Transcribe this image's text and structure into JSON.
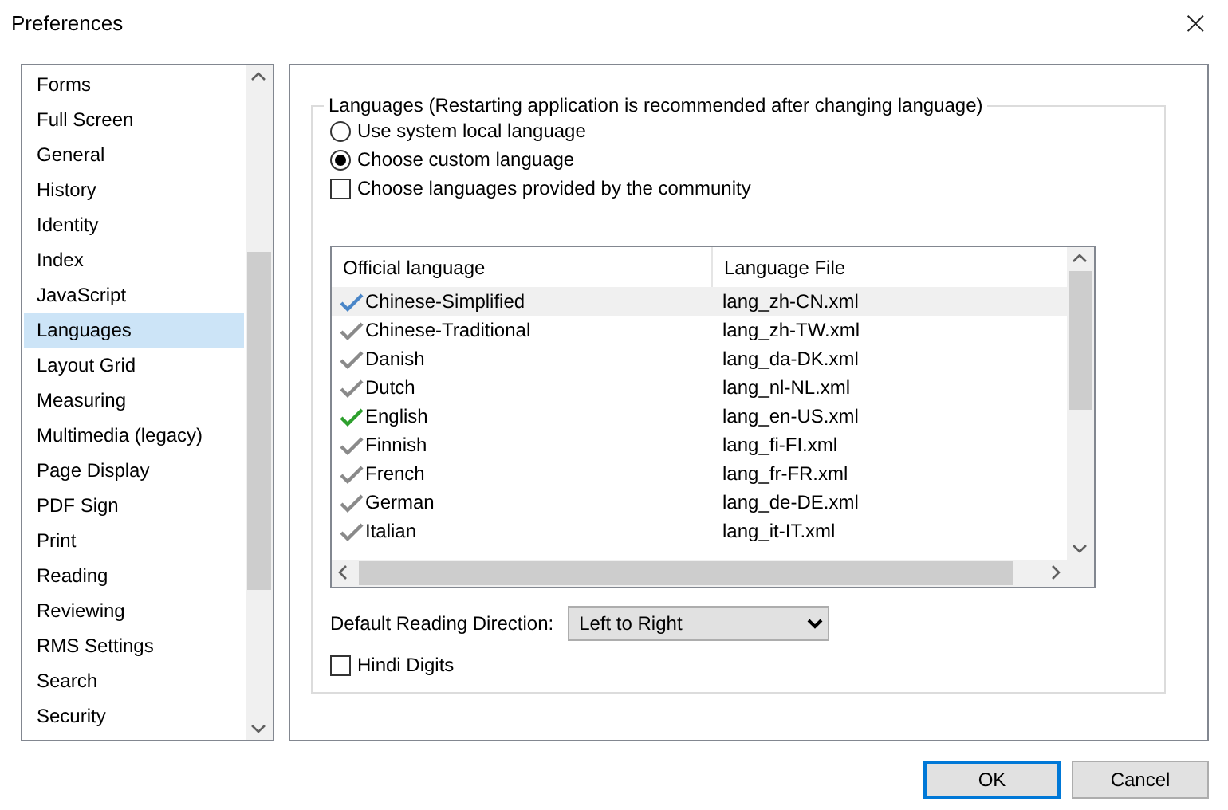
{
  "window": {
    "title": "Preferences",
    "close": "×"
  },
  "sidebar": {
    "items": [
      {
        "label": "Forms",
        "selected": false
      },
      {
        "label": "Full Screen",
        "selected": false
      },
      {
        "label": "General",
        "selected": false
      },
      {
        "label": "History",
        "selected": false
      },
      {
        "label": "Identity",
        "selected": false
      },
      {
        "label": "Index",
        "selected": false
      },
      {
        "label": "JavaScript",
        "selected": false
      },
      {
        "label": "Languages",
        "selected": true
      },
      {
        "label": "Layout Grid",
        "selected": false
      },
      {
        "label": "Measuring",
        "selected": false
      },
      {
        "label": "Multimedia (legacy)",
        "selected": false
      },
      {
        "label": "Page Display",
        "selected": false
      },
      {
        "label": "PDF Sign",
        "selected": false
      },
      {
        "label": "Print",
        "selected": false
      },
      {
        "label": "Reading",
        "selected": false
      },
      {
        "label": "Reviewing",
        "selected": false
      },
      {
        "label": "RMS Settings",
        "selected": false
      },
      {
        "label": "Search",
        "selected": false
      },
      {
        "label": "Security",
        "selected": false
      }
    ]
  },
  "languages": {
    "title": "Languages (Restarting application is recommended after changing language)",
    "options": [
      {
        "kind": "radio",
        "label": "Use system local language",
        "selected": false
      },
      {
        "kind": "radio",
        "label": "Choose custom language",
        "selected": true
      },
      {
        "kind": "checkbox",
        "label": "Choose languages provided by the community",
        "checked": false
      }
    ],
    "table": {
      "columns": [
        "Official language",
        "Language File"
      ],
      "rows": [
        {
          "name": "Chinese-Simplified",
          "file": "lang_zh-CN.xml",
          "selected": true,
          "current": false
        },
        {
          "name": "Chinese-Traditional",
          "file": "lang_zh-TW.xml",
          "selected": false,
          "current": false
        },
        {
          "name": "Danish",
          "file": "lang_da-DK.xml",
          "selected": false,
          "current": false
        },
        {
          "name": "Dutch",
          "file": "lang_nl-NL.xml",
          "selected": false,
          "current": false
        },
        {
          "name": "English",
          "file": "lang_en-US.xml",
          "selected": false,
          "current": true
        },
        {
          "name": "Finnish",
          "file": "lang_fi-FI.xml",
          "selected": false,
          "current": false
        },
        {
          "name": "French",
          "file": "lang_fr-FR.xml",
          "selected": false,
          "current": false
        },
        {
          "name": "German",
          "file": "lang_de-DE.xml",
          "selected": false,
          "current": false
        },
        {
          "name": "Italian",
          "file": "lang_it-IT.xml",
          "selected": false,
          "current": false
        }
      ]
    },
    "direction": {
      "label": "Default Reading Direction:",
      "value": "Left to Right"
    },
    "hindi_digits": {
      "label": "Hindi Digits",
      "checked": false
    }
  },
  "buttons": [
    {
      "label": "OK",
      "default": true
    },
    {
      "label": "Cancel",
      "default": false
    }
  ]
}
